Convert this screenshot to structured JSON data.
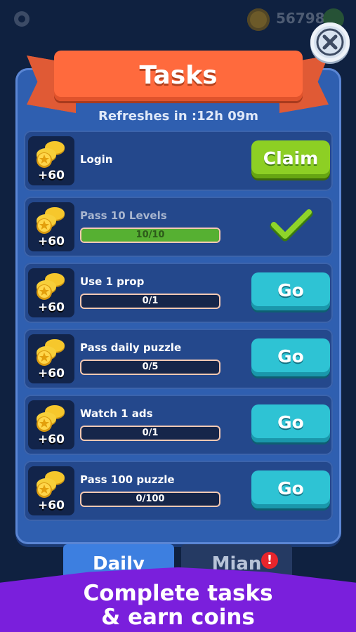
{
  "header": {
    "coin_count": "56798",
    "coin_icon": "gold-coin-icon"
  },
  "panel": {
    "title": "Tasks",
    "refresh": "Refreshes in :12h 09m"
  },
  "tasks": [
    {
      "name": "Login",
      "reward": "+60",
      "progress_text": null,
      "progress_fraction": null,
      "action": "Claim",
      "state": "claimable"
    },
    {
      "name": "Pass 10 Levels",
      "reward": "+60",
      "progress_text": "10/10",
      "progress_fraction": 1.0,
      "action": null,
      "state": "completed"
    },
    {
      "name": "Use 1 prop",
      "reward": "+60",
      "progress_text": "0/1",
      "progress_fraction": 0,
      "action": "Go",
      "state": "open"
    },
    {
      "name": "Pass daily puzzle",
      "reward": "+60",
      "progress_text": "0/5",
      "progress_fraction": 0,
      "action": "Go",
      "state": "open"
    },
    {
      "name": "Watch 1 ads",
      "reward": "+60",
      "progress_text": "0/1",
      "progress_fraction": 0,
      "action": "Go",
      "state": "open"
    },
    {
      "name": "Pass 100 puzzle",
      "reward": "+60",
      "progress_text": "0/100",
      "progress_fraction": 0,
      "action": "Go",
      "state": "open"
    }
  ],
  "tabs": {
    "daily": "Daily",
    "main": "Mian",
    "alert": "!"
  },
  "promo": {
    "line1": "Complete tasks",
    "line2": "& earn coins"
  },
  "colors": {
    "claim": "#8dcf24",
    "go": "#2ec3d4",
    "ribbon": "#ff6a3d",
    "panel": "#2f5fb0",
    "promo": "#7a1fdc"
  }
}
